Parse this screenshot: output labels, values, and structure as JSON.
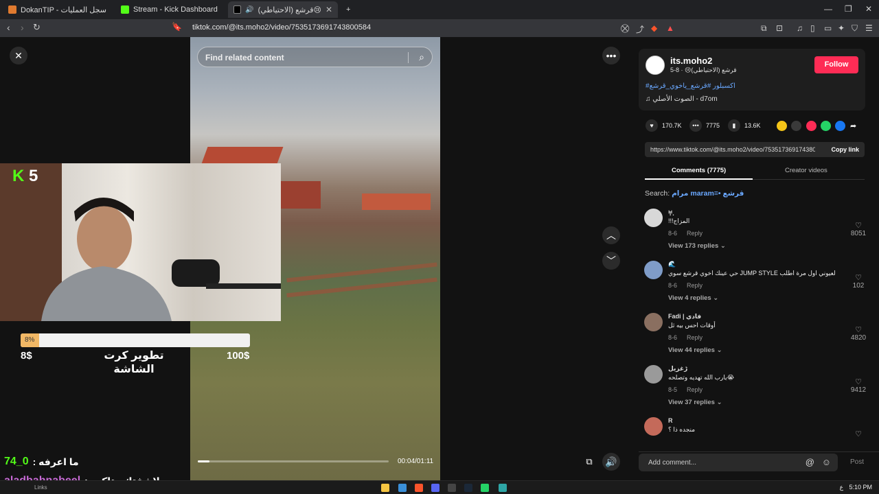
{
  "browser": {
    "tabs": [
      {
        "title": "DokanTIP - سجل العمليات",
        "color": "#e07a2f"
      },
      {
        "title": "Stream - Kick Dashboard",
        "color": "#53fc18"
      },
      {
        "title": "قرشع (الاحتياطي)😢 (@its.moho2",
        "color": "#000000"
      }
    ],
    "url": "tiktok.com/@its.moho2/video/7535173691743800584",
    "new_tab": "+"
  },
  "video": {
    "search_placeholder": "Find related content",
    "time": "00:04/01:11",
    "progress": 0.06
  },
  "overlay": {
    "kick_count": "5",
    "goal_percent": "8%",
    "goal_fraction": 0.08,
    "goal_min": "8$",
    "goal_max": "100$",
    "goal_title": "تطوير كرت الشاشة",
    "chat": [
      {
        "user": "74_0",
        "message": ": ما اعرفه"
      },
      {
        "user": "aladbahnabeel",
        "message": ": لاشفتك متاكده"
      }
    ]
  },
  "profile": {
    "username": "its.moho2",
    "display_name": "قرشع (الاحتياطي)😢 · 8-5",
    "follow_label": "Follow",
    "caption": "#اكسبلور #قرشع_ياخوي_قرشع",
    "music": "♫ الصوت الأصلي - d7om"
  },
  "stats": {
    "likes": "170.7K",
    "comments": "7775",
    "saves": "13.6K"
  },
  "share": {
    "link": "https://www.tiktok.com/@its.moho2/video/7535173691743800584?is_from_webapp=1",
    "copy_label": "Copy link",
    "colors": [
      "#f5c518",
      "#3a3a3a",
      "#fe2c55",
      "#25d366",
      "#1877f2"
    ]
  },
  "panel_tabs": {
    "comments": "Comments (7775)",
    "creator": "Creator videos"
  },
  "search_line": {
    "prefix": "Search: ",
    "keyword": "مرام maram≡• قرشع"
  },
  "comments": [
    {
      "name": "𐀀.",
      "text": "!!!المزاج",
      "date": "8-6",
      "reply": "Reply",
      "view": "View 173 replies",
      "likes": "8051"
    },
    {
      "name": "🌊",
      "text": "حي عينك اخوي قرشع سوي JUMP STYLE لعيوني اول مرة اطلب",
      "date": "8-6",
      "reply": "Reply",
      "view": "View 4 replies",
      "likes": "102"
    },
    {
      "name": "Fadi | فادي",
      "text": "أوقات احس بيه ثل",
      "date": "8-6",
      "reply": "Reply",
      "view": "View 44 replies",
      "likes": "4820"
    },
    {
      "name": "ڑغزيل",
      "text": "يارب الله تهديه وتصلحه😭",
      "date": "8-5",
      "reply": "Reply",
      "view": "View 37 replies",
      "likes": "9412"
    },
    {
      "name": "R",
      "text": "منجده ذا ؟",
      "date": "",
      "reply": "",
      "view": "",
      "likes": ""
    }
  ],
  "comment_input": {
    "placeholder": "Add comment...",
    "post_label": "Post"
  },
  "taskbar": {
    "links": "Links",
    "lang": "ع",
    "time": "5:10 PM"
  }
}
